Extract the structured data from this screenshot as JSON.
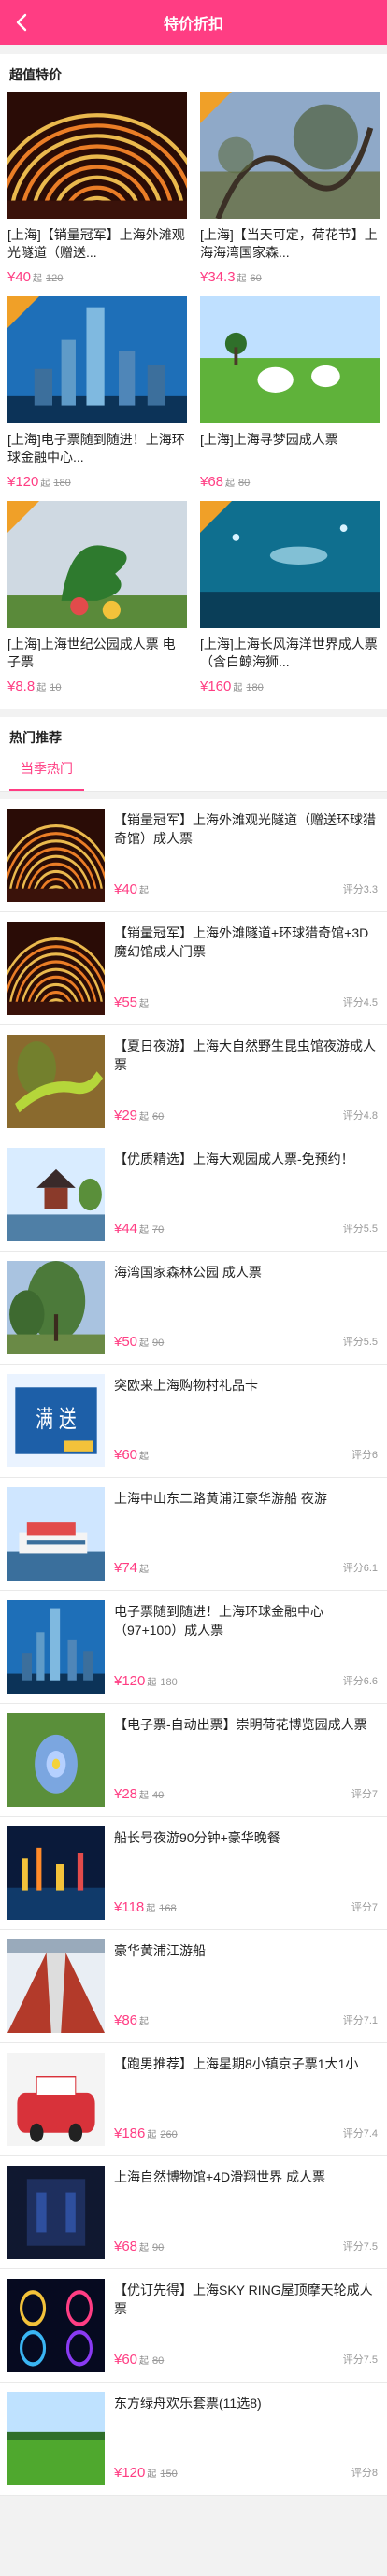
{
  "header": {
    "title": "特价折扣"
  },
  "deals": {
    "title": "超值特价",
    "items": [
      {
        "name": "[上海]【销量冠军】上海外滩观光隧道（赠送...",
        "price": "¥40",
        "unit": "起",
        "orig": "120",
        "ribbon": false,
        "scene": "tunnel"
      },
      {
        "name": "[上海]【当天可定，荷花节】上海海湾国家森...",
        "price": "¥34.3",
        "unit": "起",
        "orig": "60",
        "ribbon": true,
        "scene": "forest"
      },
      {
        "name": "[上海]电子票随到随进！上海环球金融中心...",
        "price": "¥120",
        "unit": "起",
        "orig": "180",
        "ribbon": true,
        "scene": "tower"
      },
      {
        "name": "[上海]上海寻梦园成人票",
        "price": "¥68",
        "unit": "起",
        "orig": "80",
        "ribbon": false,
        "scene": "sheep"
      },
      {
        "name": "[上海]上海世纪公园成人票 电子票",
        "price": "¥8.8",
        "unit": "起",
        "orig": "10",
        "ribbon": true,
        "scene": "topiary"
      },
      {
        "name": "[上海]上海长风海洋世界成人票（含白鲸海狮...",
        "price": "¥160",
        "unit": "起",
        "orig": "180",
        "ribbon": true,
        "scene": "aquarium"
      }
    ]
  },
  "hot": {
    "title": "热门推荐",
    "tab": "当季热门",
    "items": [
      {
        "name": "【销量冠军】上海外滩观光隧道（赠送环球猎奇馆）成人票",
        "price": "¥40",
        "unit": "起",
        "orig": "",
        "score": "评分3.3",
        "scene": "tunnel"
      },
      {
        "name": "【销量冠军】上海外滩隧道+环球猎奇馆+3D魔幻馆成人门票",
        "price": "¥55",
        "unit": "起",
        "orig": "",
        "score": "评分4.5",
        "scene": "tunnel"
      },
      {
        "name": "【夏日夜游】上海大自然野生昆虫馆夜游成人票",
        "price": "¥29",
        "unit": "起",
        "orig": "60",
        "score": "评分4.8",
        "scene": "lizard"
      },
      {
        "name": "【优质精选】上海大观园成人票-免预约！",
        "price": "¥44",
        "unit": "起",
        "orig": "70",
        "score": "评分5.5",
        "scene": "pagoda"
      },
      {
        "name": "海湾国家森林公园 成人票",
        "price": "¥50",
        "unit": "起",
        "orig": "90",
        "score": "评分5.5",
        "scene": "forest2"
      },
      {
        "name": "突欧来上海购物村礼品卡",
        "price": "¥60",
        "unit": "起",
        "orig": "",
        "score": "评分6",
        "scene": "card"
      },
      {
        "name": "上海中山东二路黄浦江豪华游船 夜游",
        "price": "¥74",
        "unit": "起",
        "orig": "",
        "score": "评分6.1",
        "scene": "ship"
      },
      {
        "name": "电子票随到随进！上海环球金融中心（97+100）成人票",
        "price": "¥120",
        "unit": "起",
        "orig": "180",
        "score": "评分6.6",
        "scene": "tower"
      },
      {
        "name": "【电子票-自动出票】崇明荷花博览园成人票",
        "price": "¥28",
        "unit": "起",
        "orig": "40",
        "score": "评分7",
        "scene": "lotus"
      },
      {
        "name": "船长号夜游90分钟+豪华晚餐",
        "price": "¥118",
        "unit": "起",
        "orig": "168",
        "score": "评分7",
        "scene": "night"
      },
      {
        "name": "豪华黄浦江游船",
        "price": "¥86",
        "unit": "起",
        "orig": "",
        "score": "评分7.1",
        "scene": "deck"
      },
      {
        "name": "【跑男推荐】上海星期8小镇京子票1大1小",
        "price": "¥186",
        "unit": "起",
        "orig": "260",
        "score": "评分7.4",
        "scene": "kids"
      },
      {
        "name": "上海自然博物馆+4D滑翔世界 成人票",
        "price": "¥68",
        "unit": "起",
        "orig": "90",
        "score": "评分7.5",
        "scene": "museum"
      },
      {
        "name": "【优订先得】上海SKY RING屋顶摩天轮成人票",
        "price": "¥60",
        "unit": "起",
        "orig": "80",
        "score": "评分7.5",
        "scene": "rings"
      },
      {
        "name": "东方绿舟欢乐套票(11选8)",
        "price": "¥120",
        "unit": "起",
        "orig": "150",
        "score": "评分8",
        "scene": "field"
      }
    ]
  },
  "colors": {
    "brand": "#ff3d83",
    "ribbon": "#f0a028"
  }
}
